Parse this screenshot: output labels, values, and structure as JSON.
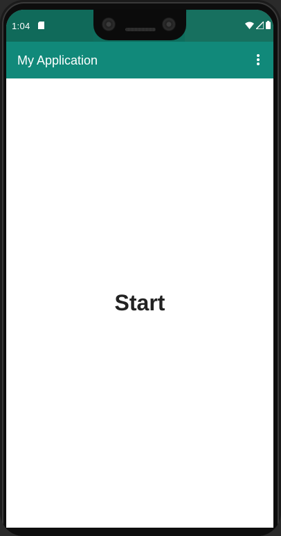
{
  "status_bar": {
    "time": "1:04",
    "icons": [
      "sd-card-icon",
      "wifi-icon",
      "signal-icon",
      "battery-icon"
    ]
  },
  "app_bar": {
    "title": "My Application",
    "menu_icon": "more-vert-icon"
  },
  "content": {
    "label": "Start"
  },
  "colors": {
    "status_bar": "#0e6d5d",
    "app_bar": "#11897a",
    "background": "#ffffff",
    "text_primary": "#222222"
  }
}
